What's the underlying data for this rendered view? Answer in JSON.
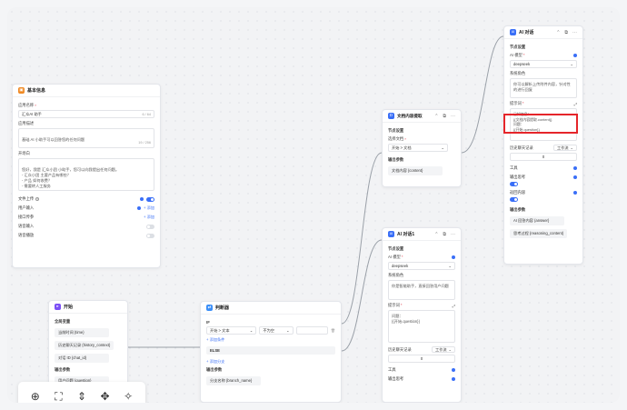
{
  "colors": {
    "accent": "#3a6ff7",
    "highlight": "#e5252a"
  },
  "basic_info": {
    "title": "基本信息",
    "icon": "orange-app-icon",
    "app_name_label": "应用名称",
    "app_name_value": "汇众AI 助手",
    "app_name_count": "6 / 64",
    "app_desc_label": "应用描述",
    "app_desc_value": "基础 AI 小助手可以回答您的任何问题",
    "app_desc_count": "19 / 256",
    "opening_label": "开场白",
    "opening_value": "您好，我是 汇众小团 小助手，您可以向我提出任何问题。\n- 汇众小团 主要产品有哪些？\n- 产品 如何收费？\n- 需要转人工服务",
    "file_upload_label": "文件上传",
    "user_input_label": "用户输入",
    "add_label": "+ 添加",
    "api_param_label": "接口传参",
    "voice_input_label": "语音输入",
    "voice_play_label": "语音播放"
  },
  "start": {
    "title": "开始",
    "global_vars_label": "全局变量",
    "vars": [
      "当前时间 {time}",
      "历史聊天记录 {history_context}",
      "对话 ID {chat_id}"
    ],
    "output_label": "输出参数",
    "outputs": [
      "用户问题 {question}"
    ]
  },
  "condition": {
    "title": "判断器",
    "if_label": "IF",
    "field": "开始 > 文本",
    "operator": "不为空",
    "add_condition": "+ 添加条件",
    "else_label": "ELSE",
    "add_branch": "+ 添加分支",
    "output_label": "输出参数",
    "output": "分支名称 {branch_name}"
  },
  "doc_extract": {
    "title": "文档内容提取",
    "settings_label": "节点设置",
    "select_doc_label": "选择文档",
    "select_doc_value": "开始 > 文档",
    "output_label": "输出参数",
    "output": "文档内容 {content}"
  },
  "ai_chat_top": {
    "title": "AI 对话",
    "settings_label": "节点设置",
    "model_label": "AI 模型",
    "model_value": "deepseek",
    "system_role_label": "系统角色",
    "system_role_value": "你可以解析上传附件内容，针对性的进行回复",
    "prompt_label": "提示词",
    "prompt_value": "已知信息：\n{{文档内容提取.content}}\n问题：\n{{开始.question}}",
    "history_label": "历史聊天记录",
    "history_mode": "工作流",
    "history_count": "0",
    "tools_label": "工具",
    "output_think_label": "输出思考",
    "return_content_label": "返回内容",
    "output_label": "输出参数",
    "outputs": [
      "AI 回答内容 {answer}",
      "思考过程 {reasoning_content}"
    ]
  },
  "ai_chat_bottom": {
    "title": "AI 对话1",
    "settings_label": "节点设置",
    "model_label": "AI 模型",
    "model_value": "deepseek",
    "system_role_label": "系统角色",
    "system_role_value": "你是智能助手，直接回答用户问题",
    "prompt_label": "提示词",
    "prompt_value": "问题：\n{{开始.question}}",
    "history_label": "历史聊天记录",
    "history_mode": "工作流",
    "history_count": "0",
    "tools_label": "工具",
    "output_think_label": "输出思考"
  },
  "toolbar": {
    "zoom_in": "⊕",
    "fit": "⛶",
    "collapse": "⇕",
    "expand": "✥",
    "beautify": "✧"
  },
  "ui": {
    "star": "*",
    "help": "?",
    "chevron": "⌄",
    "chevron_small": "⌄",
    "edit": "✎",
    "expand": "⤢",
    "more": "⋯",
    "collapse_arrow": "⌃",
    "copy": "⧉",
    "delete": "🗑",
    "avatar": "AI",
    "start_avatar": "▸",
    "cond_avatar": "⇄",
    "doc_avatar": "D",
    "app_avatar": "▣"
  }
}
